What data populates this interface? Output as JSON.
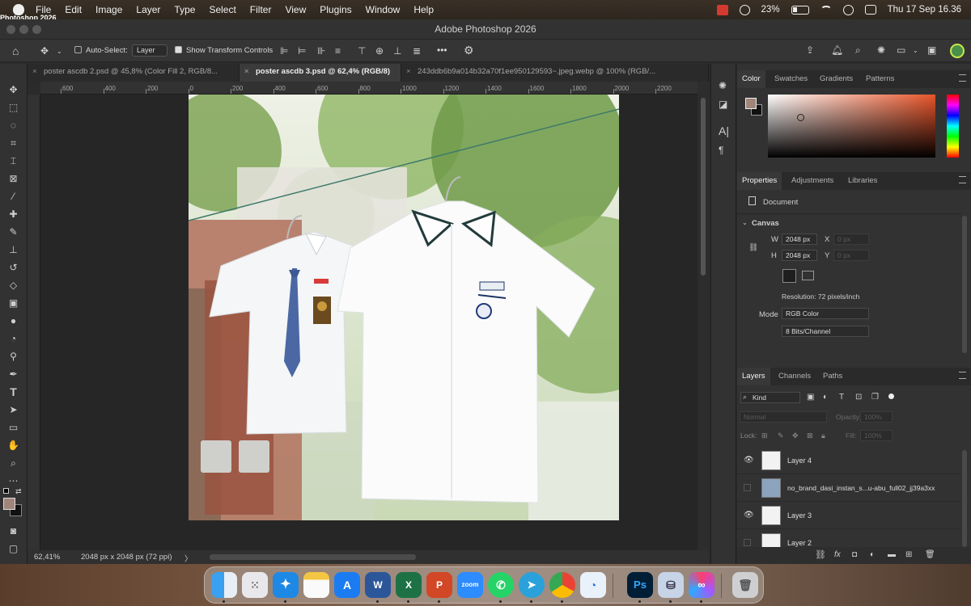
{
  "menubar": {
    "items": [
      "Photoshop 2026",
      "File",
      "Edit",
      "Image",
      "Layer",
      "Type",
      "Select",
      "Filter",
      "View",
      "Plugins",
      "Window",
      "Help"
    ],
    "battery": "23%",
    "clock": "Thu 17 Sep  16.36"
  },
  "window": {
    "title": "Adobe Photoshop 2026"
  },
  "options": {
    "auto_select_label": "Auto-Select:",
    "auto_select_value": "Layer",
    "show_transform_label": "Show Transform Controls",
    "more_label": "•••"
  },
  "tabs": [
    {
      "label": "poster ascdb 2.psd @ 45,8% (Color Fill 2, RGB/8..."
    },
    {
      "label": "poster ascdb 3.psd @ 62,4% (RGB/8)"
    },
    {
      "label": "243ddb6b9a014b32a70f1ee950129593~.jpeg.webp @ 100% (RGB/..."
    }
  ],
  "ruler": {
    "h_labels": [
      "600",
      "400",
      "200",
      "0",
      "200",
      "400",
      "600",
      "800",
      "1000",
      "1200",
      "1400",
      "1600",
      "1800",
      "2000",
      "2200",
      "2"
    ]
  },
  "status": {
    "zoom": "62,41%",
    "doc_info": "2048 px x 2048 px (72 ppi)",
    "arrow": "〉"
  },
  "color_panel": {
    "tabs": [
      "Color",
      "Swatches",
      "Gradients",
      "Patterns"
    ],
    "foreground": "#a0857a",
    "background": "#111111",
    "spectrum_color": "#e8552a"
  },
  "properties_panel": {
    "tabs": [
      "Properties",
      "Adjustments",
      "Libraries"
    ],
    "document_label": "Document",
    "section": "Canvas",
    "w_label": "W",
    "w_value": "2048 px",
    "h_label": "H",
    "h_value": "2048 px",
    "x_label": "X",
    "x_value": "0 px",
    "y_label": "Y",
    "y_value": "0 px",
    "resolution": "Resolution: 72 pixels/inch",
    "mode_label": "Mode",
    "mode_value": "RGB Color",
    "bits_value": "8 Bits/Channel"
  },
  "layers_panel": {
    "tabs": [
      "Layers",
      "Channels",
      "Paths"
    ],
    "filter_label": "Kind",
    "blend_mode": "Normal",
    "opacity_label": "Opacity:",
    "opacity_value": "100%",
    "lock_label": "Lock:",
    "fill_label": "Fill:",
    "fill_value": "100%",
    "layers": [
      {
        "name": "Layer 4",
        "visible": true
      },
      {
        "name": "no_brand_dasi_instan_s...u-abu_full02_jj39a3xx",
        "visible": false
      },
      {
        "name": "Layer 3",
        "visible": true
      },
      {
        "name": "Layer 2",
        "visible": false
      }
    ]
  },
  "dock": {
    "apps": [
      "Finder",
      "Launchpad",
      "Safari",
      "Notes",
      "App Store",
      "Word",
      "Excel",
      "PowerPoint",
      "Zoom",
      "WhatsApp",
      "Telegram",
      "Chrome",
      "Quick Share",
      "Photoshop",
      "Docker",
      "Creative Cloud",
      "Trash"
    ],
    "zoom_label": "zoom",
    "ps_label": "Ps"
  }
}
